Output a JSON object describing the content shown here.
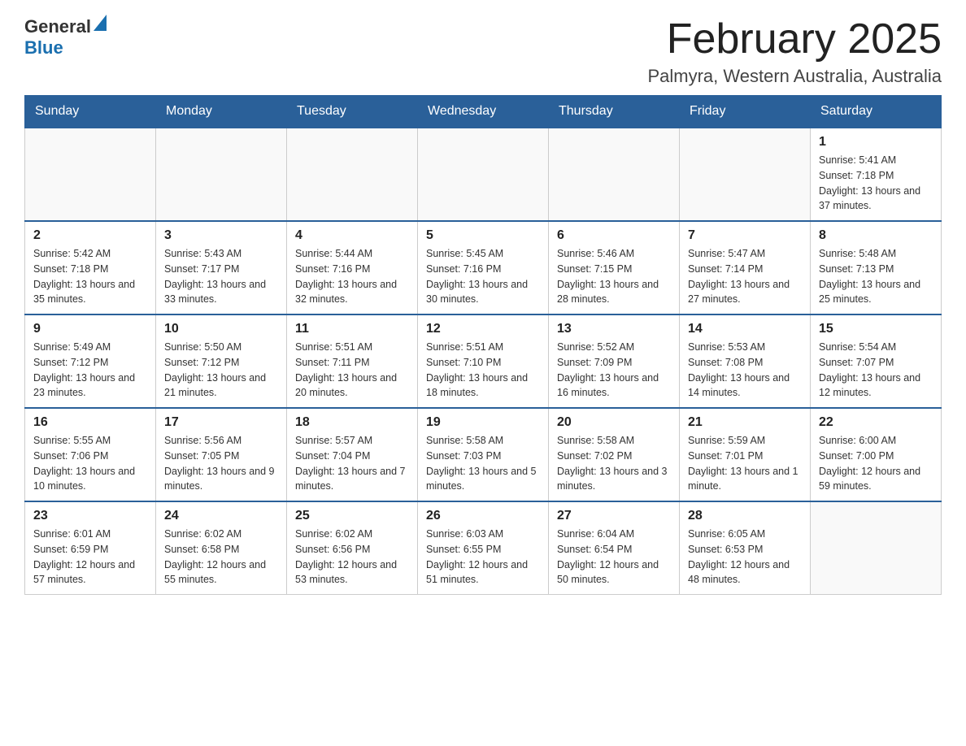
{
  "header": {
    "logo_general": "General",
    "logo_blue": "Blue",
    "month_title": "February 2025",
    "location": "Palmyra, Western Australia, Australia"
  },
  "weekdays": [
    "Sunday",
    "Monday",
    "Tuesday",
    "Wednesday",
    "Thursday",
    "Friday",
    "Saturday"
  ],
  "weeks": [
    [
      {
        "day": "",
        "info": ""
      },
      {
        "day": "",
        "info": ""
      },
      {
        "day": "",
        "info": ""
      },
      {
        "day": "",
        "info": ""
      },
      {
        "day": "",
        "info": ""
      },
      {
        "day": "",
        "info": ""
      },
      {
        "day": "1",
        "info": "Sunrise: 5:41 AM\nSunset: 7:18 PM\nDaylight: 13 hours and 37 minutes."
      }
    ],
    [
      {
        "day": "2",
        "info": "Sunrise: 5:42 AM\nSunset: 7:18 PM\nDaylight: 13 hours and 35 minutes."
      },
      {
        "day": "3",
        "info": "Sunrise: 5:43 AM\nSunset: 7:17 PM\nDaylight: 13 hours and 33 minutes."
      },
      {
        "day": "4",
        "info": "Sunrise: 5:44 AM\nSunset: 7:16 PM\nDaylight: 13 hours and 32 minutes."
      },
      {
        "day": "5",
        "info": "Sunrise: 5:45 AM\nSunset: 7:16 PM\nDaylight: 13 hours and 30 minutes."
      },
      {
        "day": "6",
        "info": "Sunrise: 5:46 AM\nSunset: 7:15 PM\nDaylight: 13 hours and 28 minutes."
      },
      {
        "day": "7",
        "info": "Sunrise: 5:47 AM\nSunset: 7:14 PM\nDaylight: 13 hours and 27 minutes."
      },
      {
        "day": "8",
        "info": "Sunrise: 5:48 AM\nSunset: 7:13 PM\nDaylight: 13 hours and 25 minutes."
      }
    ],
    [
      {
        "day": "9",
        "info": "Sunrise: 5:49 AM\nSunset: 7:12 PM\nDaylight: 13 hours and 23 minutes."
      },
      {
        "day": "10",
        "info": "Sunrise: 5:50 AM\nSunset: 7:12 PM\nDaylight: 13 hours and 21 minutes."
      },
      {
        "day": "11",
        "info": "Sunrise: 5:51 AM\nSunset: 7:11 PM\nDaylight: 13 hours and 20 minutes."
      },
      {
        "day": "12",
        "info": "Sunrise: 5:51 AM\nSunset: 7:10 PM\nDaylight: 13 hours and 18 minutes."
      },
      {
        "day": "13",
        "info": "Sunrise: 5:52 AM\nSunset: 7:09 PM\nDaylight: 13 hours and 16 minutes."
      },
      {
        "day": "14",
        "info": "Sunrise: 5:53 AM\nSunset: 7:08 PM\nDaylight: 13 hours and 14 minutes."
      },
      {
        "day": "15",
        "info": "Sunrise: 5:54 AM\nSunset: 7:07 PM\nDaylight: 13 hours and 12 minutes."
      }
    ],
    [
      {
        "day": "16",
        "info": "Sunrise: 5:55 AM\nSunset: 7:06 PM\nDaylight: 13 hours and 10 minutes."
      },
      {
        "day": "17",
        "info": "Sunrise: 5:56 AM\nSunset: 7:05 PM\nDaylight: 13 hours and 9 minutes."
      },
      {
        "day": "18",
        "info": "Sunrise: 5:57 AM\nSunset: 7:04 PM\nDaylight: 13 hours and 7 minutes."
      },
      {
        "day": "19",
        "info": "Sunrise: 5:58 AM\nSunset: 7:03 PM\nDaylight: 13 hours and 5 minutes."
      },
      {
        "day": "20",
        "info": "Sunrise: 5:58 AM\nSunset: 7:02 PM\nDaylight: 13 hours and 3 minutes."
      },
      {
        "day": "21",
        "info": "Sunrise: 5:59 AM\nSunset: 7:01 PM\nDaylight: 13 hours and 1 minute."
      },
      {
        "day": "22",
        "info": "Sunrise: 6:00 AM\nSunset: 7:00 PM\nDaylight: 12 hours and 59 minutes."
      }
    ],
    [
      {
        "day": "23",
        "info": "Sunrise: 6:01 AM\nSunset: 6:59 PM\nDaylight: 12 hours and 57 minutes."
      },
      {
        "day": "24",
        "info": "Sunrise: 6:02 AM\nSunset: 6:58 PM\nDaylight: 12 hours and 55 minutes."
      },
      {
        "day": "25",
        "info": "Sunrise: 6:02 AM\nSunset: 6:56 PM\nDaylight: 12 hours and 53 minutes."
      },
      {
        "day": "26",
        "info": "Sunrise: 6:03 AM\nSunset: 6:55 PM\nDaylight: 12 hours and 51 minutes."
      },
      {
        "day": "27",
        "info": "Sunrise: 6:04 AM\nSunset: 6:54 PM\nDaylight: 12 hours and 50 minutes."
      },
      {
        "day": "28",
        "info": "Sunrise: 6:05 AM\nSunset: 6:53 PM\nDaylight: 12 hours and 48 minutes."
      },
      {
        "day": "",
        "info": ""
      }
    ]
  ]
}
